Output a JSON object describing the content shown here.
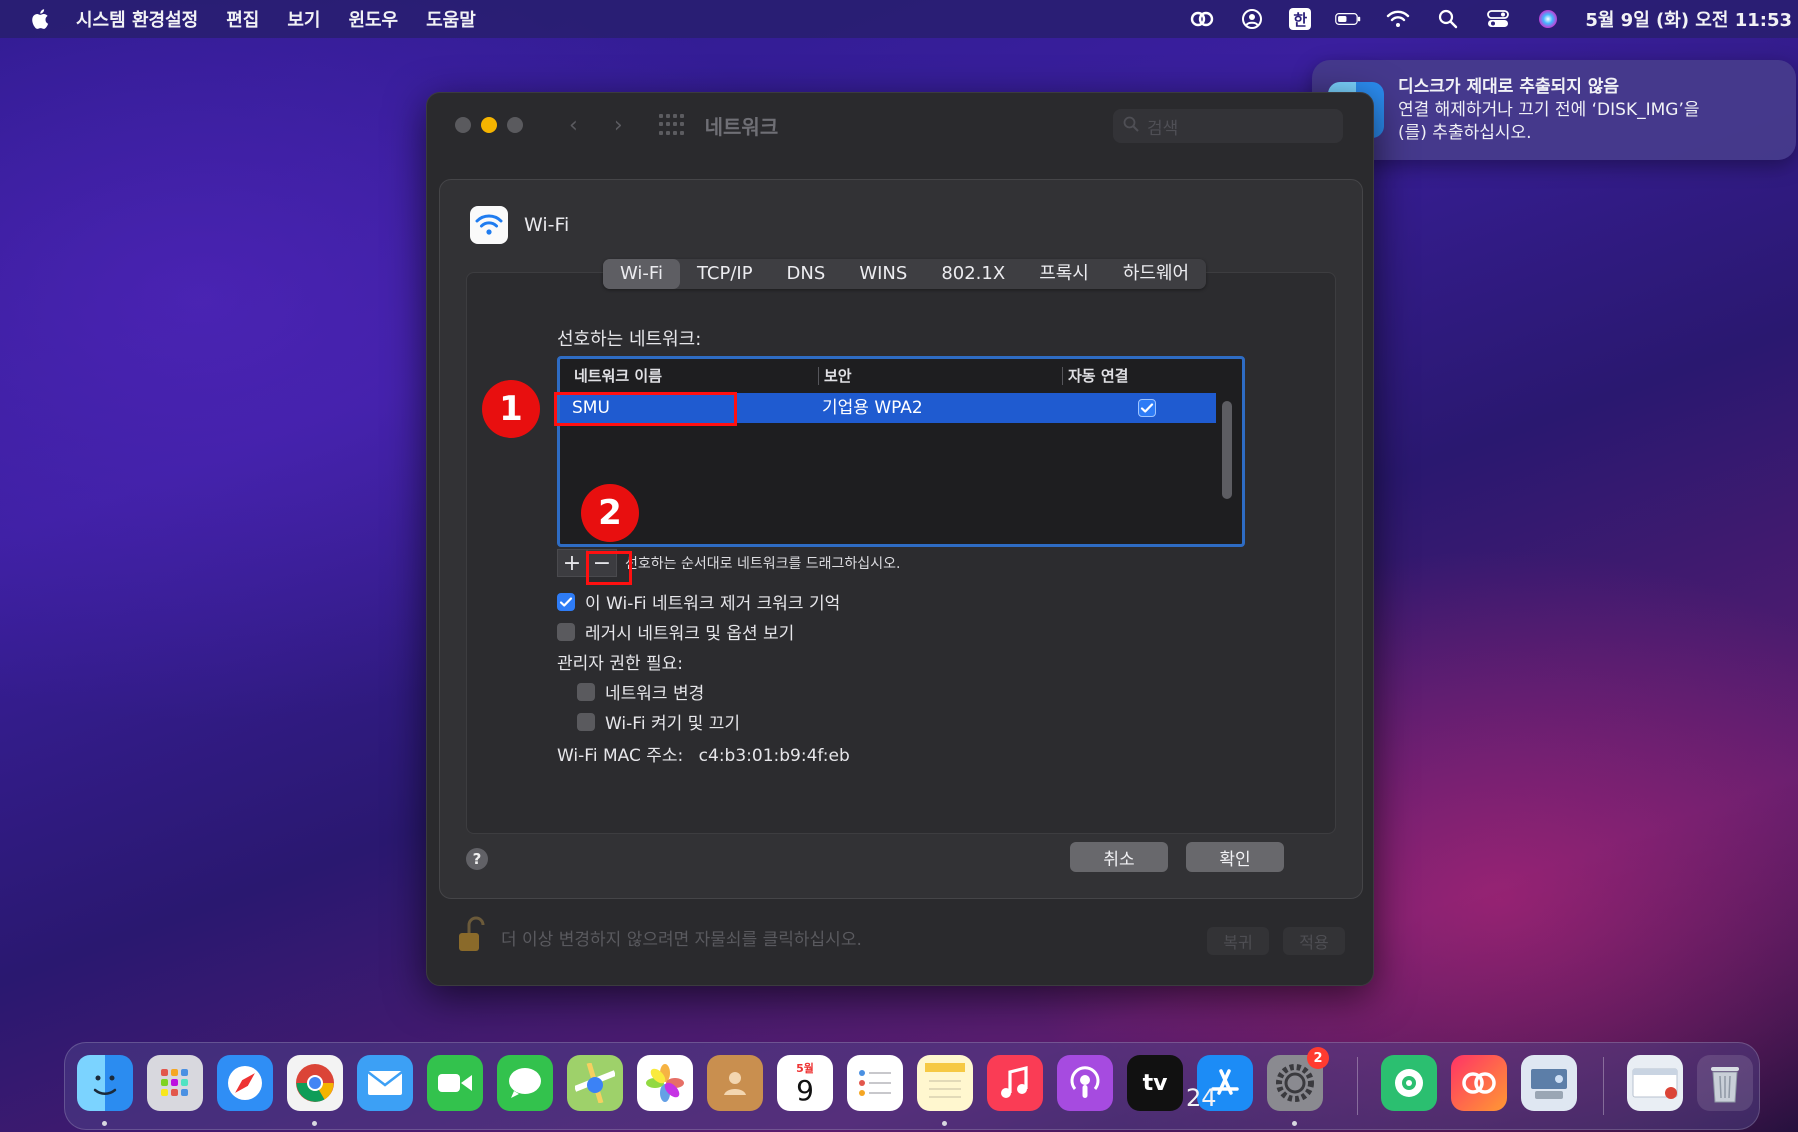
{
  "menubar": {
    "app_name": "시스템 환경설정",
    "items": [
      "편집",
      "보기",
      "윈도우",
      "도움말"
    ],
    "input_source": "한",
    "clock": "5월 9일 (화) 오전 11:53"
  },
  "notification": {
    "title": "디스크가 제대로 추출되지 않음",
    "line1": "연결 해제하거나 끄기 전에 ‘DISK_IMG’을",
    "line2": "(를) 추출하십시오."
  },
  "window": {
    "title": "네트워크",
    "search_placeholder": "검색"
  },
  "sheet": {
    "header_label": "Wi-Fi",
    "tabs": [
      {
        "label": "Wi-Fi",
        "active": true
      },
      {
        "label": "TCP/IP",
        "active": false
      },
      {
        "label": "DNS",
        "active": false
      },
      {
        "label": "WINS",
        "active": false
      },
      {
        "label": "802.1X",
        "active": false
      },
      {
        "label": "프록시",
        "active": false
      },
      {
        "label": "하드웨어",
        "active": false
      }
    ],
    "preferred_label": "선호하는 네트워크:",
    "table": {
      "columns": [
        "네트워크 이름",
        "보안",
        "자동 연결"
      ],
      "rows": [
        {
          "name": "SMU",
          "security": "기업용 WPA2",
          "auto_join": true
        }
      ]
    },
    "plus_label": "+",
    "minus_label": "−",
    "drag_hint": "선호하는 순서대로 네트워크를 드래그하십시오.",
    "options": [
      {
        "label": "이 Wi-Fi 네트워크 제거 크워크 기억",
        "checked": true
      },
      {
        "label": "레거시 네트워크 및 옵션 보기",
        "checked": false
      }
    ],
    "admin_label": "관리자 권한 필요:",
    "admin_options": [
      {
        "label": "네트워크 변경",
        "checked": false
      },
      {
        "label": "Wi-Fi 켜기 및 끄기",
        "checked": false
      }
    ],
    "mac_label": "Wi-Fi MAC 주소:",
    "mac_value": "c4:b3:01:b9:4f:eb",
    "help": "?",
    "cancel": "취소",
    "ok": "확인"
  },
  "footer": {
    "lock_text": "더 이상 변경하지 않으려면 자물쇠를 클릭하십시오.",
    "revert": "복귀",
    "apply": "적용"
  },
  "annotations": [
    "1",
    "2"
  ],
  "dock": {
    "calendar_month": "5월",
    "calendar_day": "9",
    "tv_label": "tv",
    "settings_badge": "2"
  },
  "page_number": "24",
  "colors": {
    "accent": "#2e7cf6",
    "selection": "#1f5bd0",
    "annotation": "#e80f0f"
  }
}
